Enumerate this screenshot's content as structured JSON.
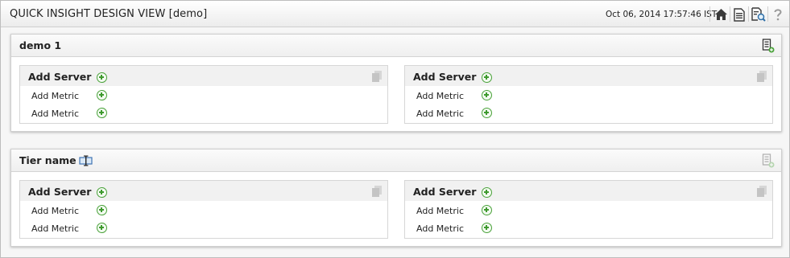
{
  "header": {
    "title": "QUICK INSIGHT DESIGN VIEW [demo]",
    "timestamp": "Oct 06, 2014 17:57:46 IST",
    "icons": [
      "home-icon",
      "report-icon",
      "search-report-icon",
      "help-icon"
    ]
  },
  "tiers": [
    {
      "name": "demo 1",
      "servers": [
        {
          "label": "Add Server",
          "metrics": [
            "Add Metric",
            "Add Metric"
          ]
        },
        {
          "label": "Add Server",
          "metrics": [
            "Add Metric",
            "Add Metric"
          ]
        }
      ]
    },
    {
      "name": "Tier name",
      "servers": [
        {
          "label": "Add Server",
          "metrics": [
            "Add Metric",
            "Add Metric"
          ]
        },
        {
          "label": "Add Server",
          "metrics": [
            "Add Metric",
            "Add Metric"
          ]
        }
      ]
    }
  ],
  "colors": {
    "accent_green": "#3e9a2e",
    "toolbar_icon": "#3a3a3a",
    "help_icon": "#9a9a9a"
  }
}
